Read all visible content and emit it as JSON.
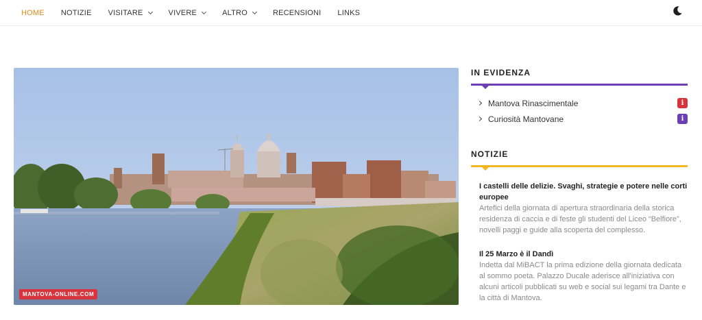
{
  "nav": {
    "items": [
      {
        "label": "HOME",
        "active": true,
        "dropdown": false
      },
      {
        "label": "NOTIZIE",
        "active": false,
        "dropdown": false
      },
      {
        "label": "VISITARE",
        "active": false,
        "dropdown": true
      },
      {
        "label": "VIVERE",
        "active": false,
        "dropdown": true
      },
      {
        "label": "ALTRO",
        "active": false,
        "dropdown": true
      },
      {
        "label": "RECENSIONI",
        "active": false,
        "dropdown": false
      },
      {
        "label": "LINKS",
        "active": false,
        "dropdown": false
      }
    ],
    "theme_icon": "moon-icon",
    "active_color": "#e08a1c"
  },
  "hero": {
    "badge": "MANTOVA-ONLINE.COM"
  },
  "sidebar": {
    "featured": {
      "title": "IN EVIDENZA",
      "accent": "#6c3fb5",
      "items": [
        {
          "label": "Mantova Rinascimentale",
          "badge_color": "#d8343d",
          "badge_icon": "info-icon"
        },
        {
          "label": "Curiosità Mantovane",
          "badge_color": "#6c3fb5",
          "badge_icon": "info-icon"
        }
      ]
    },
    "news": {
      "title": "NOTIZIE",
      "accent": "#f2b824",
      "items": [
        {
          "title": "I castelli delle delizie. Svaghi, strategie e potere nelle corti europee",
          "body": "Artefici della giornata di apertura straordinaria della storica residenza di caccia e di feste gli studenti del Liceo “Belfiore”, novelli paggi e guide alla scoperta del complesso."
        },
        {
          "title": "Il 25 Marzo è il Dandì",
          "body": "Indetta dal MiBACT la prima edizione della giornata dedicata al sommo poeta. Palazzo Ducale aderisce all'iniziativa con alcuni articoli pubblicati su web e social sui legami tra Dante e la città di Mantova."
        }
      ]
    }
  }
}
